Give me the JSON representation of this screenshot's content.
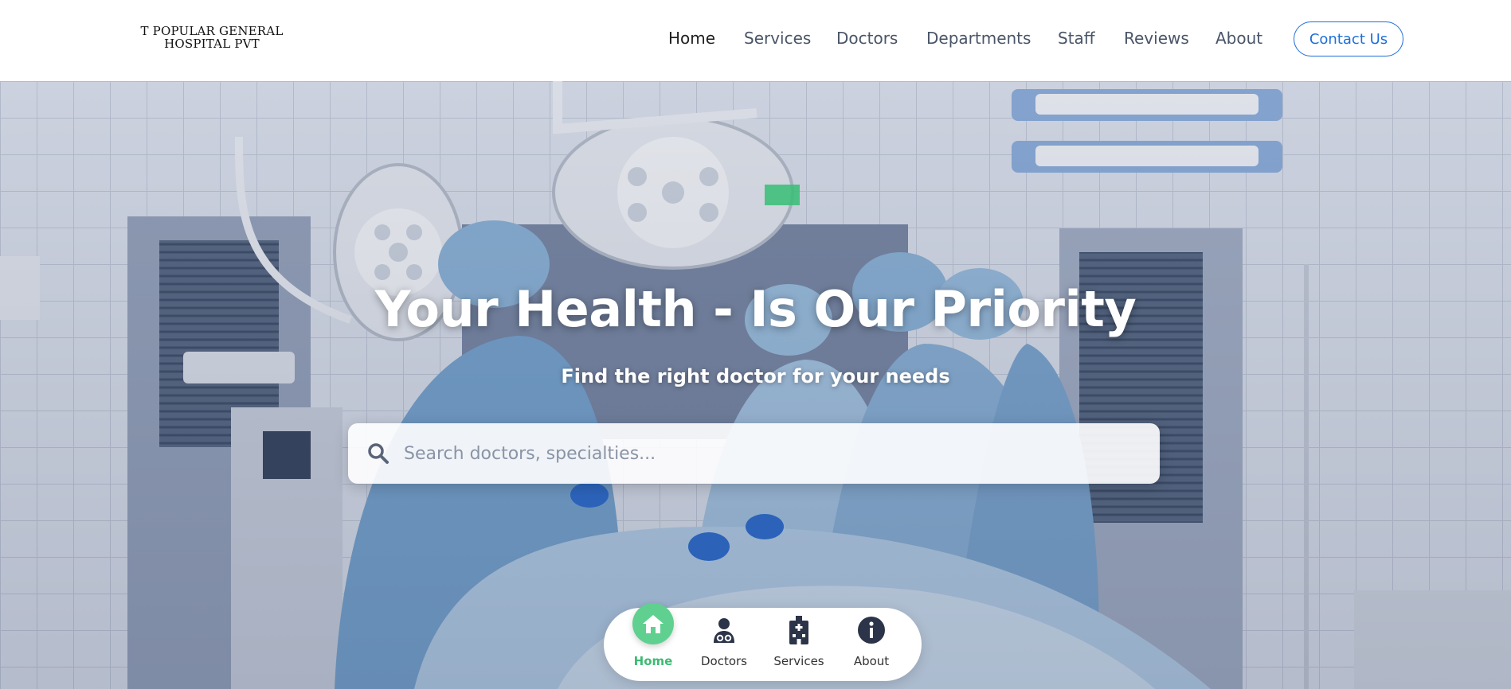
{
  "header": {
    "logo_line1": "T POPULAR GENERAL",
    "logo_line2": "HOSPITAL PVT",
    "nav": [
      {
        "label": "Home",
        "active": true
      },
      {
        "label": "Services",
        "active": false
      },
      {
        "label": "Doctors",
        "active": false
      },
      {
        "label": "Departments",
        "active": false
      },
      {
        "label": "Staff",
        "active": false
      },
      {
        "label": "Reviews",
        "active": false
      },
      {
        "label": "About",
        "active": false
      }
    ],
    "contact_label": "Contact Us"
  },
  "hero": {
    "title": "Your Health - Is Our Priority",
    "subtitle": "Find the right doctor for your needs",
    "search_placeholder": "Search doctors, specialties..."
  },
  "dock": {
    "items": [
      {
        "label": "Home",
        "icon": "home-icon",
        "active": true
      },
      {
        "label": "Doctors",
        "icon": "doctor-icon",
        "active": false
      },
      {
        "label": "Services",
        "icon": "hospital-icon",
        "active": false
      },
      {
        "label": "About",
        "icon": "info-icon",
        "active": false
      }
    ]
  },
  "colors": {
    "accent": "#1e6fd9",
    "dock_active": "#5fd08f",
    "dock_active_label": "#3dbb73"
  }
}
